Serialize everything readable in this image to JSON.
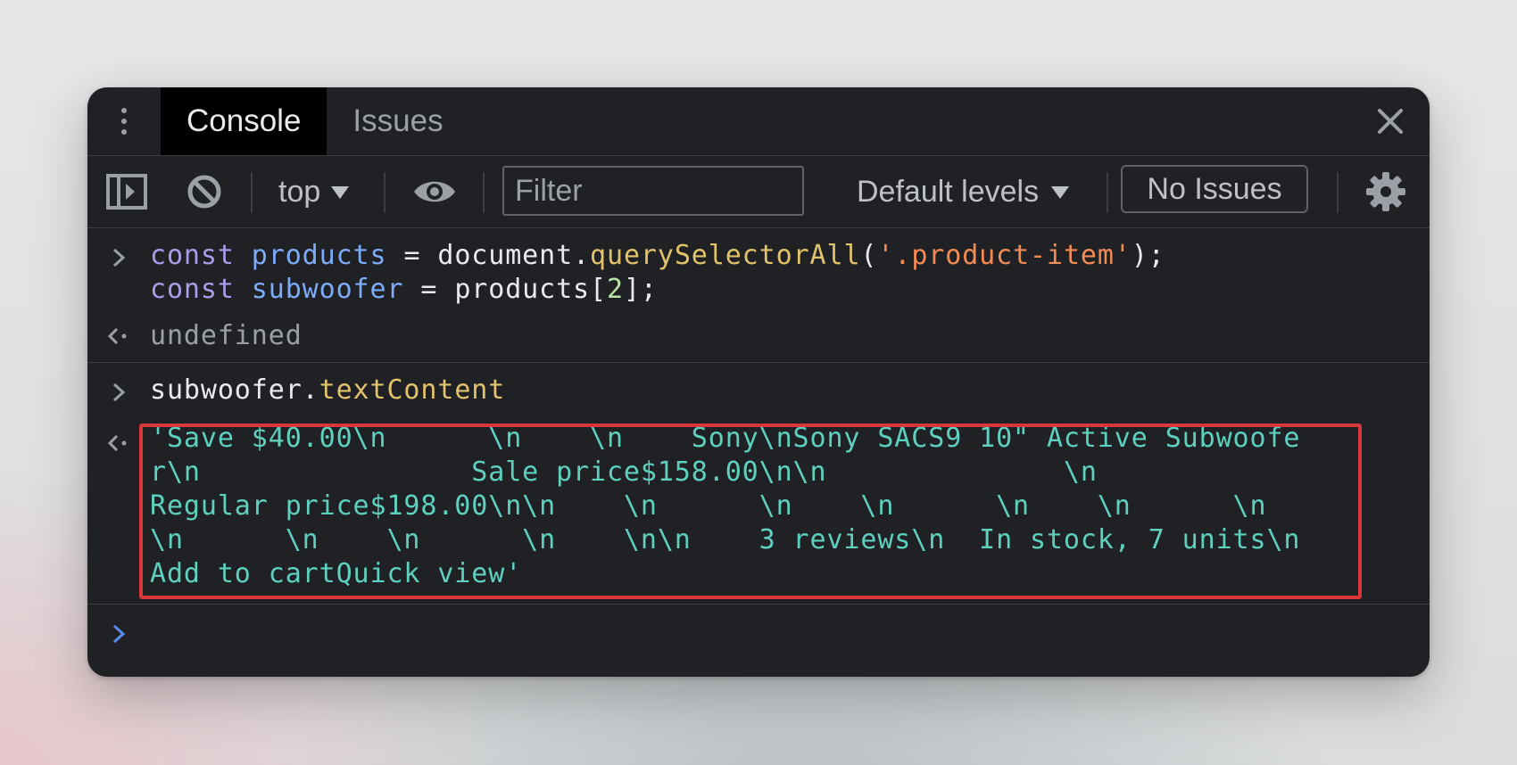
{
  "tabs": [
    {
      "label": "Console",
      "active": true
    },
    {
      "label": "Issues",
      "active": false
    }
  ],
  "toolbar": {
    "context": "top",
    "filter_placeholder": "Filter",
    "levels": "Default levels",
    "issues": "No Issues"
  },
  "console": {
    "input1": {
      "line1": {
        "kw": "const",
        "var": "products",
        "eq": " = ",
        "obj": "document.",
        "fn": "querySelectorAll",
        "open": "(",
        "str": "'.product-item'",
        "close": ");"
      },
      "line2": {
        "kw": "const",
        "var": "subwoofer",
        "eq": " = ",
        "obj": "products[",
        "num": "2",
        "close": "];"
      }
    },
    "result1": "undefined",
    "input2": {
      "obj": "subwoofer.",
      "prop": "textContent"
    },
    "result2_lines": [
      "'Save $40.00\\n      \\n    \\n    Sony\\nSony SACS9 10\" Active Subwoofe",
      "r\\n                Sale price$158.00\\n\\n              \\n",
      "Regular price$198.00\\n\\n    \\n      \\n    \\n      \\n    \\n      \\n",
      "\\n      \\n    \\n      \\n    \\n\\n    3 reviews\\n  In stock, 7 units\\n",
      "Add to cartQuick view'"
    ]
  },
  "colors": {
    "panel_bg": "#202124",
    "highlight_border": "#d9373c",
    "output_text": "#5ed0c0"
  },
  "icons": [
    "kebab-menu-icon",
    "close-icon",
    "sidebar-toggle-icon",
    "clear-console-icon",
    "eye-icon",
    "gear-icon",
    "prompt-arrow-icon",
    "result-arrow-icon"
  ]
}
